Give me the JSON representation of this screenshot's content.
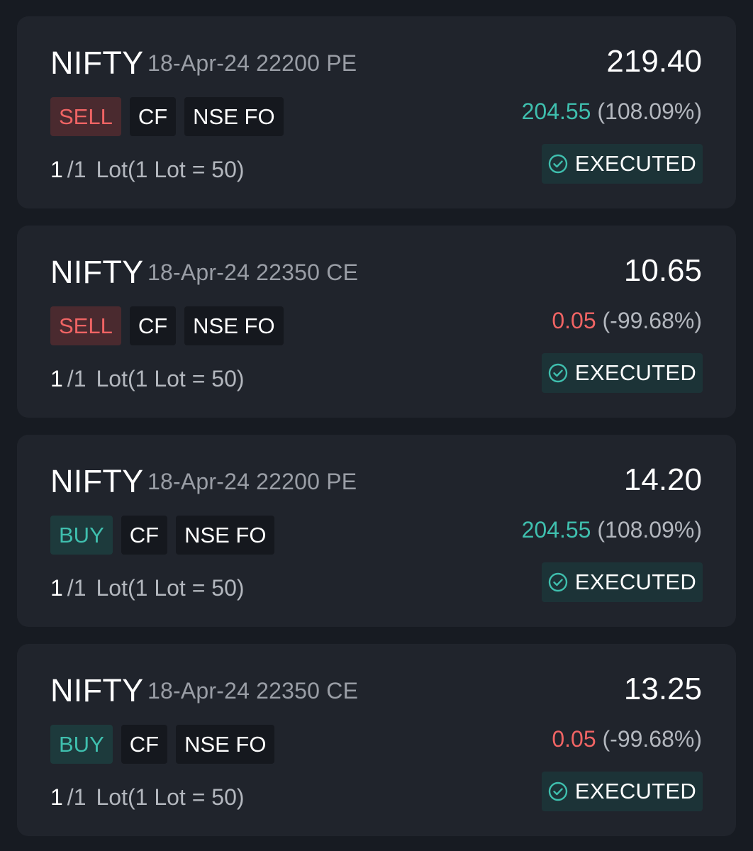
{
  "orders": [
    {
      "symbol": "NIFTY",
      "contract": "18-Apr-24 22200 PE",
      "ltp": "219.40",
      "change": "204.55",
      "change_direction": "up",
      "change_pct": "(108.09%)",
      "side": "SELL",
      "product": "CF",
      "exchange": "NSE FO",
      "qty_filled": "1",
      "qty_total": "/1",
      "lot_text": "Lot(1 Lot = 50)",
      "status": "EXECUTED",
      "status_icon": "check-circle-icon"
    },
    {
      "symbol": "NIFTY",
      "contract": "18-Apr-24 22350 CE",
      "ltp": "10.65",
      "change": "0.05",
      "change_direction": "down",
      "change_pct": "(-99.68%)",
      "side": "SELL",
      "product": "CF",
      "exchange": "NSE FO",
      "qty_filled": "1",
      "qty_total": "/1",
      "lot_text": "Lot(1 Lot = 50)",
      "status": "EXECUTED",
      "status_icon": "check-circle-icon"
    },
    {
      "symbol": "NIFTY",
      "contract": "18-Apr-24 22200 PE",
      "ltp": "14.20",
      "change": "204.55",
      "change_direction": "up",
      "change_pct": "(108.09%)",
      "side": "BUY",
      "product": "CF",
      "exchange": "NSE FO",
      "qty_filled": "1",
      "qty_total": "/1",
      "lot_text": "Lot(1 Lot = 50)",
      "status": "EXECUTED",
      "status_icon": "check-circle-icon"
    },
    {
      "symbol": "NIFTY",
      "contract": "18-Apr-24 22350 CE",
      "ltp": "13.25",
      "change": "0.05",
      "change_direction": "down",
      "change_pct": "(-99.68%)",
      "side": "BUY",
      "product": "CF",
      "exchange": "NSE FO",
      "qty_filled": "1",
      "qty_total": "/1",
      "lot_text": "Lot(1 Lot = 50)",
      "status": "EXECUTED",
      "status_icon": "check-circle-icon"
    }
  ],
  "colors": {
    "background": "#171b22",
    "card": "#20242c",
    "positive": "#3fbfae",
    "negative": "#f06464",
    "muted_text": "#9a9ea6",
    "sell_tag_bg": "#4a2a2f",
    "buy_tag_bg": "#1d3a3c",
    "executed_bg": "#1c3337"
  }
}
